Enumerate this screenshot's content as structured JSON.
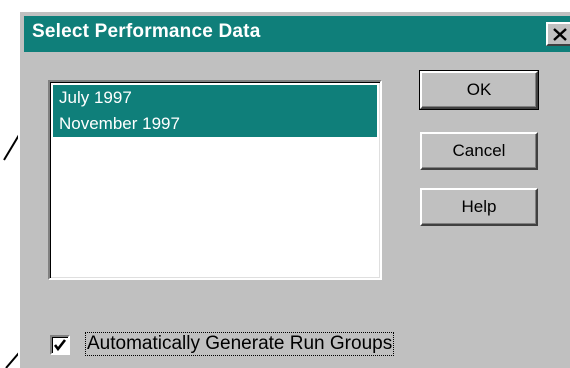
{
  "dialog": {
    "title": "Select Performance Data",
    "close_label": "×"
  },
  "list": {
    "items": [
      "July 1997",
      "November 1997"
    ],
    "selected": [
      "July 1997",
      "November 1997"
    ]
  },
  "buttons": {
    "ok": "OK",
    "cancel": "Cancel",
    "help": "Help"
  },
  "option": {
    "label": "Automatically Generate Run Groups",
    "checked": true
  },
  "colors": {
    "titlebar": "#0f7f7a",
    "selection": "#0f7f7a",
    "face": "#c0c0c0"
  },
  "icons": [
    "close-icon",
    "checkmark-icon",
    "pointer-arrow-icon"
  ]
}
